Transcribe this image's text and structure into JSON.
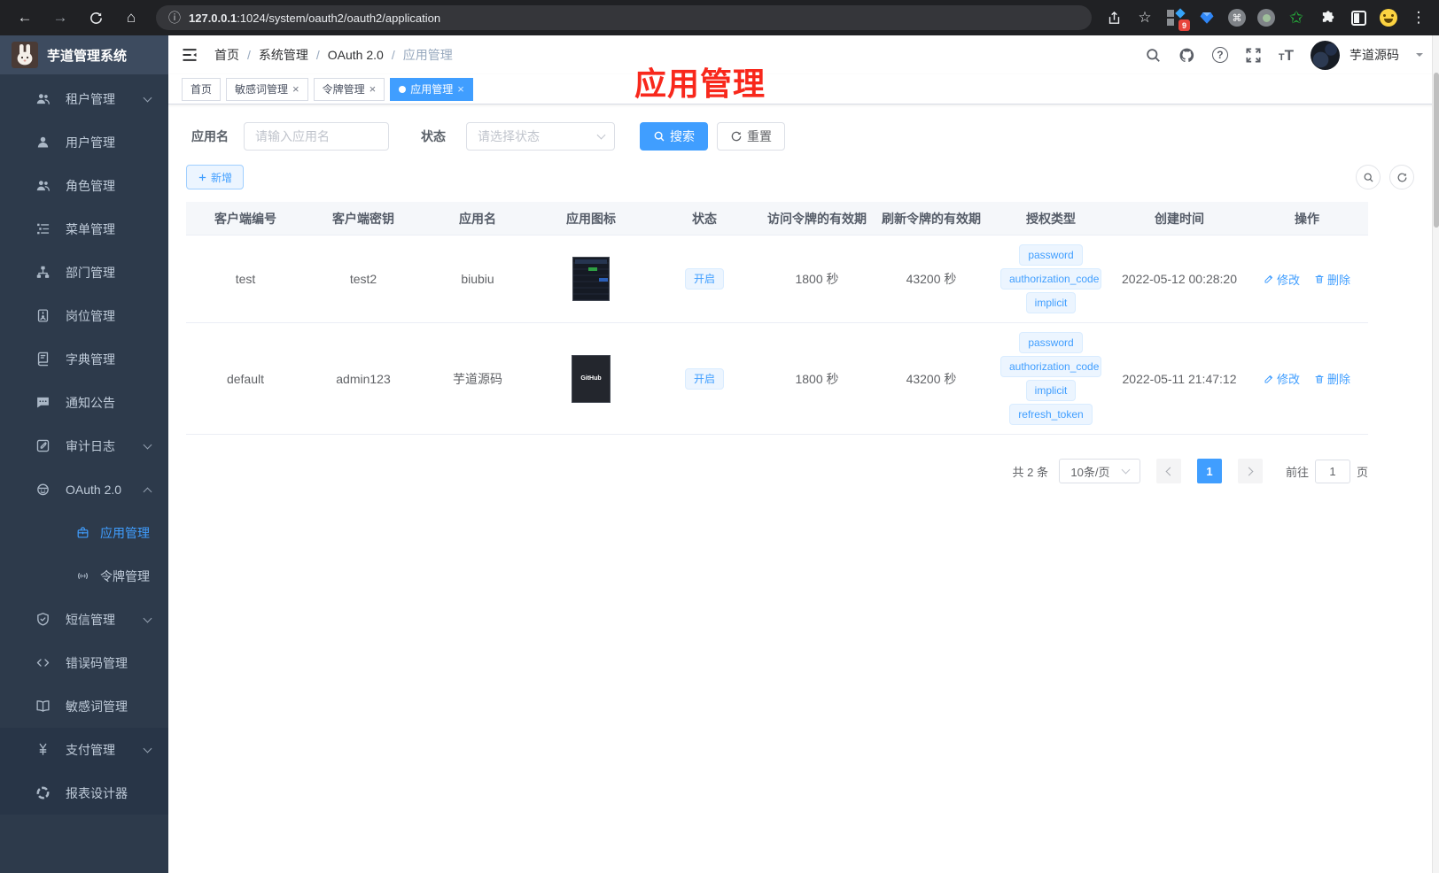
{
  "browser": {
    "url_host": "127.0.0.1",
    "url_path": ":1024/system/oauth2/oauth2/application",
    "extension_badge": "9",
    "glyphs": {
      "back": "←",
      "forward": "→",
      "home": "⌂",
      "info": "ⓘ",
      "star": "☆",
      "menu": "⋮",
      "command": "⌘",
      "green_star": "✩"
    }
  },
  "sidebar": {
    "logo_title": "芋道管理系统",
    "items": [
      {
        "id": "tenant",
        "label": "租户管理",
        "icon": "users",
        "arrow": "down"
      },
      {
        "id": "user",
        "label": "用户管理",
        "icon": "user"
      },
      {
        "id": "role",
        "label": "角色管理",
        "icon": "users"
      },
      {
        "id": "menu",
        "label": "菜单管理",
        "icon": "menu-tree"
      },
      {
        "id": "dept",
        "label": "部门管理",
        "icon": "org-tree"
      },
      {
        "id": "post",
        "label": "岗位管理",
        "icon": "id-badge"
      },
      {
        "id": "dict",
        "label": "字典管理",
        "icon": "dictionary"
      },
      {
        "id": "notice",
        "label": "通知公告",
        "icon": "message"
      },
      {
        "id": "audit-log",
        "label": "审计日志",
        "icon": "edit-log",
        "arrow": "down"
      },
      {
        "id": "oauth2",
        "label": "OAuth 2.0",
        "icon": "robot",
        "arrow": "up"
      },
      {
        "id": "oauth2-application",
        "label": "应用管理",
        "icon": "briefcase",
        "child": true,
        "active": true
      },
      {
        "id": "oauth2-token",
        "label": "令牌管理",
        "icon": "signal",
        "child": true
      },
      {
        "id": "sms",
        "label": "短信管理",
        "icon": "shield-check",
        "arrow": "down"
      },
      {
        "id": "error-code",
        "label": "错误码管理",
        "icon": "code"
      },
      {
        "id": "sensitive-word",
        "label": "敏感词管理",
        "icon": "book-open"
      },
      {
        "id": "pay",
        "label": "支付管理",
        "icon": "yen",
        "arrow": "down",
        "dim": true
      },
      {
        "id": "report-designer",
        "label": "报表设计器",
        "icon": "chart-wheel",
        "dim": true
      }
    ]
  },
  "header": {
    "breadcrumb": [
      "首页",
      "系统管理",
      "OAuth 2.0",
      "应用管理"
    ],
    "username": "芋道源码",
    "help_glyph": "?"
  },
  "tabs": [
    {
      "label": "首页",
      "closable": false,
      "active": false
    },
    {
      "label": "敏感词管理",
      "closable": true,
      "active": false
    },
    {
      "label": "令牌管理",
      "closable": true,
      "active": false
    },
    {
      "label": "应用管理",
      "closable": true,
      "active": true
    }
  ],
  "ui": {
    "close_glyph": "×",
    "font_glyph": "T"
  },
  "annotation": {
    "text": "应用管理",
    "color": "#f8281c"
  },
  "filters": {
    "name_label": "应用名",
    "name_placeholder": "请输入应用名",
    "status_label": "状态",
    "status_placeholder": "请选择状态",
    "search_label": "搜索",
    "reset_label": "重置",
    "add_label": "新增"
  },
  "table": {
    "columns": [
      "客户端编号",
      "客户端密钥",
      "应用名",
      "应用图标",
      "状态",
      "访问令牌的有效期",
      "刷新令牌的有效期",
      "授权类型",
      "创建时间",
      "操作"
    ],
    "rows": [
      {
        "client_id": "test",
        "client_secret": "test2",
        "app_name": "biubiu",
        "icon_kind": "screenshot",
        "icon_label": "",
        "status": "开启",
        "access_token_ttl": "1800 秒",
        "refresh_token_ttl": "43200 秒",
        "grant_types": [
          "password",
          "authorization_code",
          "implicit"
        ],
        "created_at": "2022-05-12 00:28:20"
      },
      {
        "client_id": "default",
        "client_secret": "admin123",
        "app_name": "芋道源码",
        "icon_kind": "github",
        "icon_label": "GitHub",
        "status": "开启",
        "access_token_ttl": "1800 秒",
        "refresh_token_ttl": "43200 秒",
        "grant_types": [
          "password",
          "authorization_code",
          "implicit",
          "refresh_token"
        ],
        "created_at": "2022-05-11 21:47:12"
      }
    ],
    "edit_label": "修改",
    "delete_label": "删除"
  },
  "pagination": {
    "total_text": "共 2 条",
    "page_size_text": "10条/页",
    "current_page": "1",
    "goto_label": "前往",
    "goto_value": "1",
    "goto_suffix": "页"
  },
  "colors": {
    "primary": "#409eff",
    "sidebar_bg": "#2d3a4b",
    "sidebar_logo_bg": "#3d4b5f",
    "tag_bg": "#ecf5ff",
    "tag_border": "#d9ecff",
    "annotation_red": "#f8281c",
    "chrome_bg": "#202124",
    "table_header_bg": "#f5f7fa"
  }
}
